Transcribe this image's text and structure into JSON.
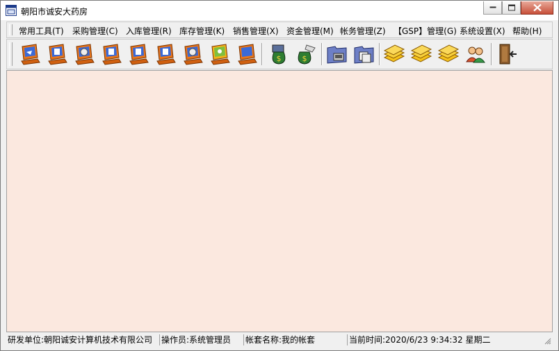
{
  "window": {
    "title": "朝阳市诚安大药房",
    "controls": {
      "minimize_icon": "minimize-icon",
      "maximize_icon": "maximize-icon",
      "close_icon": "close-icon"
    }
  },
  "menubar": {
    "items": [
      {
        "label": "常用工具(T)"
      },
      {
        "label": "采购管理(C)"
      },
      {
        "label": "入库管理(R)"
      },
      {
        "label": "库存管理(K)"
      },
      {
        "label": "销售管理(X)"
      },
      {
        "label": "资金管理(M)"
      },
      {
        "label": "帐务管理(Z)"
      },
      {
        "label": "【GSP】管理(G)"
      },
      {
        "label": "系统设置(X)"
      },
      {
        "label": "帮助(H)"
      }
    ]
  },
  "toolbar": {
    "buttons": [
      {
        "icon": "computer-arrow-icon"
      },
      {
        "icon": "computer-doc-icon"
      },
      {
        "icon": "computer-disc-icon"
      },
      {
        "icon": "computer-doc-icon"
      },
      {
        "icon": "computer-doc-icon"
      },
      {
        "icon": "computer-doc-icon"
      },
      {
        "icon": "computer-disc-icon"
      },
      {
        "icon": "computer-map-icon"
      },
      {
        "icon": "computer-icon"
      },
      {
        "icon": "money-bag-icon"
      },
      {
        "icon": "money-bag-hand-icon"
      },
      {
        "icon": "folder-computer-icon"
      },
      {
        "icon": "folder-copy-icon"
      },
      {
        "icon": "book-stack-icon"
      },
      {
        "icon": "book-stack-icon"
      },
      {
        "icon": "book-stack-icon"
      },
      {
        "icon": "users-icon"
      },
      {
        "icon": "exit-door-icon"
      }
    ]
  },
  "client_area": {
    "background": "#fbe8df"
  },
  "statusbar": {
    "developer": "研发单位:朝阳诚安计算机技术有限公司",
    "operator": "操作员:系统管理员",
    "account_set": "帐套名称:我的帐套",
    "current_time": "当前时间:2020/6/23 9:34:32 星期二"
  },
  "colors": {
    "monitor_orange": "#e8751a",
    "screen_blue": "#3b6ad6",
    "money_green": "#2e7d32",
    "book_yellow": "#f5c21b",
    "folder_blue": "#6d7fc6"
  }
}
